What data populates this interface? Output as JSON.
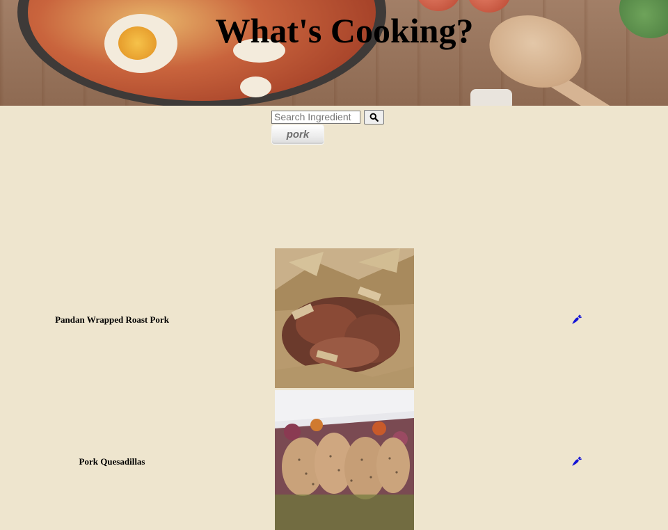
{
  "header": {
    "title": "What's Cooking?"
  },
  "search": {
    "placeholder": "Search Ingredient",
    "value": "",
    "button_icon": "search-icon"
  },
  "filters": [
    {
      "label": "pork"
    }
  ],
  "recipes": [
    {
      "name": "Pandan Wrapped Roast Pork",
      "icon": "carrot-icon"
    },
    {
      "name": "Pork Quesadillas",
      "icon": "carrot-icon"
    }
  ],
  "colors": {
    "background": "#eee5ce",
    "icon": "#1515d6"
  }
}
